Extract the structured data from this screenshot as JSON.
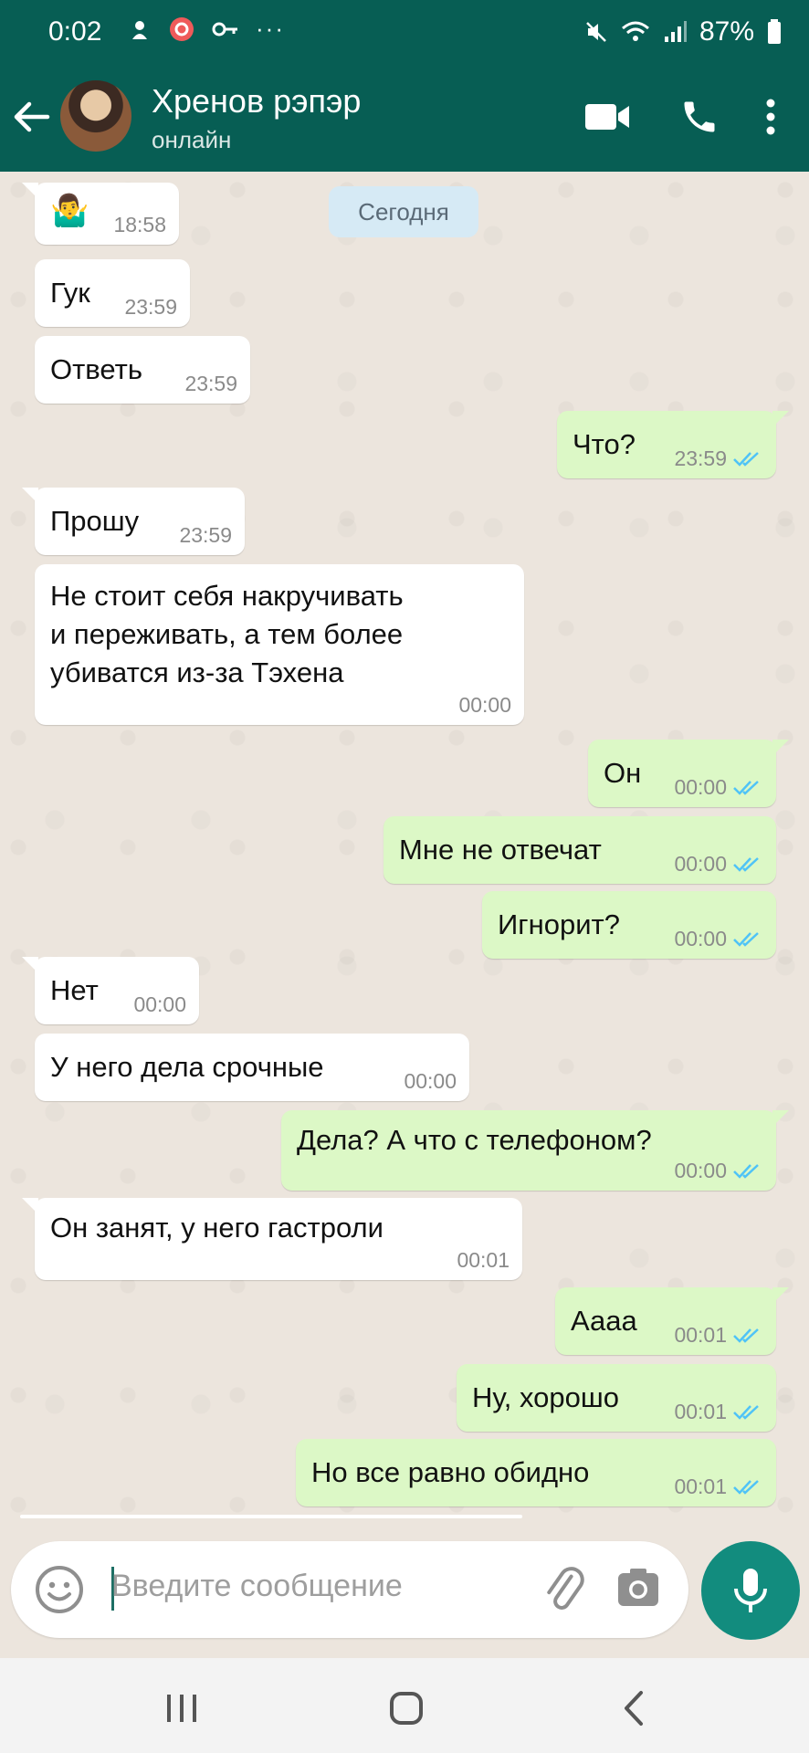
{
  "status": {
    "time": "0:02",
    "battery": "87%"
  },
  "header": {
    "title": "Хренов рэпэр",
    "subtitle": "онлайн"
  },
  "chat": {
    "date_chip": "Сегодня",
    "messages": [
      {
        "dir": "in",
        "text": "🤷‍♂️",
        "time": "18:58"
      },
      {
        "dir": "in",
        "text": "Гук",
        "time": "23:59"
      },
      {
        "dir": "in",
        "text": "Ответь",
        "time": "23:59"
      },
      {
        "dir": "out",
        "text": "Что?",
        "time": "23:59"
      },
      {
        "dir": "in",
        "text": "Прошу",
        "time": "23:59"
      },
      {
        "dir": "in",
        "text": "Не стоит себя накручивать\nи переживать, а тем более\nубиватся из-за Тэхена",
        "time": "00:00"
      },
      {
        "dir": "out",
        "text": "Он",
        "time": "00:00"
      },
      {
        "dir": "out",
        "text": "Мне не отвечат",
        "time": "00:00"
      },
      {
        "dir": "out",
        "text": "Игнорит?",
        "time": "00:00"
      },
      {
        "dir": "in",
        "text": "Нет",
        "time": "00:00"
      },
      {
        "dir": "in",
        "text": "У него дела срочные",
        "time": "00:00"
      },
      {
        "dir": "out",
        "text": "Дела? А что с телефоном?",
        "time": "00:00"
      },
      {
        "dir": "in",
        "text": "Он занят, у него гастроли",
        "time": "00:01"
      },
      {
        "dir": "out",
        "text": "Аааа",
        "time": "00:01"
      },
      {
        "dir": "out",
        "text": "Ну, хорошо",
        "time": "00:01"
      },
      {
        "dir": "out",
        "text": "Но все равно обидно",
        "time": "00:01"
      }
    ]
  },
  "input": {
    "placeholder": "Введите сообщение"
  },
  "colors": {
    "header": "#075E54",
    "outgoing_bubble": "#DCF8C6",
    "incoming_bubble": "#FFFFFF",
    "mic_button": "#128C7E",
    "read_ticks": "#4FC3F7"
  }
}
